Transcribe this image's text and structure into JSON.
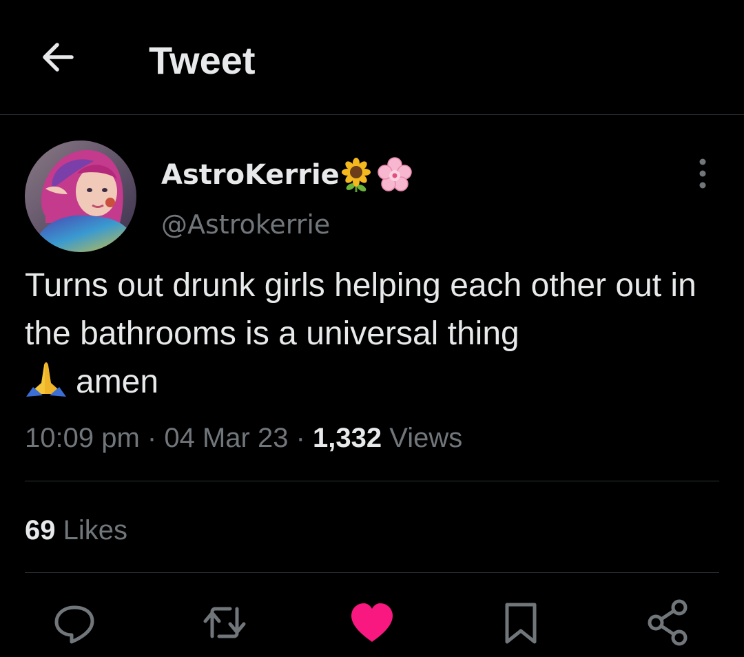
{
  "header": {
    "title": "Tweet",
    "back_icon": "arrow-left-icon"
  },
  "tweet": {
    "author": {
      "display_name": "AstroKerrie",
      "name_emojis": [
        "sunflower-icon",
        "cherry-blossom-icon"
      ],
      "handle": "@Astrokerrie",
      "avatar": "avatar-image"
    },
    "text": "Turns out drunk girls helping each other out in the bathrooms is a universal thing",
    "text_emoji": "folded-hands-icon",
    "text_tail": "amen",
    "time": "10:09 pm",
    "date": "04 Mar 23",
    "separator": "·",
    "views_count": "1,332",
    "views_label": "Views",
    "likes_count": "69",
    "likes_label": "Likes"
  },
  "actions": [
    {
      "name": "reply",
      "icon": "reply-icon"
    },
    {
      "name": "retweet",
      "icon": "retweet-icon"
    },
    {
      "name": "like",
      "icon": "heart-icon",
      "active": true
    },
    {
      "name": "bookmark",
      "icon": "bookmark-icon"
    },
    {
      "name": "share",
      "icon": "share-icon"
    }
  ],
  "colors": {
    "background": "#000000",
    "text_primary": "#e7e9ea",
    "text_secondary": "#71767b",
    "divider": "#2f3336",
    "like_active": "#f91880"
  }
}
